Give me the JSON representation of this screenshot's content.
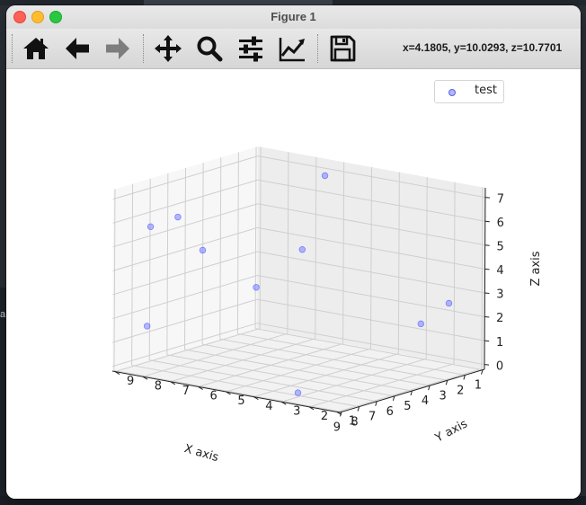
{
  "window": {
    "title": "Figure 1"
  },
  "toolbar": {
    "buttons": [
      {
        "name": "home",
        "icon": "home-icon"
      },
      {
        "name": "back",
        "icon": "arrow-left-icon"
      },
      {
        "name": "forward",
        "icon": "arrow-right-icon"
      },
      {
        "name": "pan",
        "icon": "move-icon"
      },
      {
        "name": "zoom",
        "icon": "magnifier-icon"
      },
      {
        "name": "configure-subplots",
        "icon": "sliders-icon"
      },
      {
        "name": "edit-axis",
        "icon": "line-chart-icon"
      },
      {
        "name": "save",
        "icon": "floppy-disk-icon"
      }
    ],
    "coords_readout": "x=4.1805, y=10.0293, z=10.7701"
  },
  "desktop": {
    "left_snippet": "a"
  },
  "chart_data": {
    "type": "scatter",
    "projection": "3d",
    "xlabel": "X axis",
    "ylabel": "Y axis",
    "zlabel": "Z axis",
    "xticks": [
      1,
      2,
      3,
      4,
      5,
      6,
      7,
      8,
      9
    ],
    "yticks": [
      1,
      2,
      3,
      4,
      5,
      6,
      7,
      8,
      9
    ],
    "zticks": [
      0,
      1,
      2,
      3,
      4,
      5,
      6,
      7
    ],
    "legend": {
      "location": "upper right",
      "entries": [
        "test"
      ]
    },
    "series": [
      {
        "name": "test",
        "color": "#6e78ff",
        "points": [
          {
            "x": 1.5,
            "y": 6.3,
            "z": 6.9
          },
          {
            "x": 1.2,
            "y": 2.0,
            "z": 2.4
          },
          {
            "x": 3.1,
            "y": 1.8,
            "z": 2.0
          },
          {
            "x": 4.5,
            "y": 5.2,
            "z": 4.7
          },
          {
            "x": 7.0,
            "y": 8.1,
            "z": 6.0
          },
          {
            "x": 7.6,
            "y": 8.7,
            "z": 5.6
          },
          {
            "x": 7.0,
            "y": 7.2,
            "z": 4.8
          },
          {
            "x": 6.0,
            "y": 5.9,
            "z": 3.3
          },
          {
            "x": 8.4,
            "y": 8.3,
            "z": 1.7
          },
          {
            "x": 8.8,
            "y": 2.6,
            "z": 0.2
          }
        ]
      }
    ]
  }
}
